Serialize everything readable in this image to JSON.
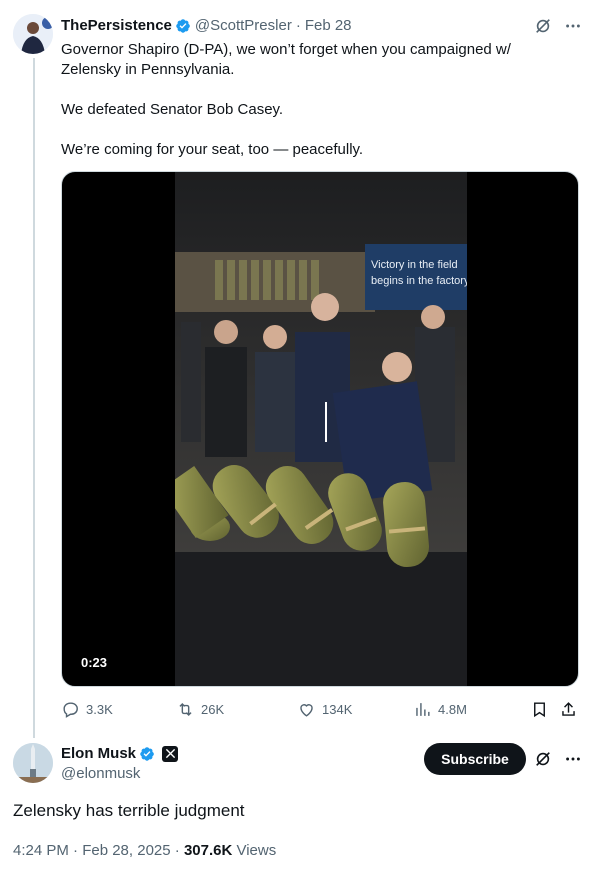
{
  "tweet1": {
    "author_name": "ThePersistence",
    "handle": "@ScottPresler",
    "separator": "·",
    "date": "Feb 28",
    "paragraphs": [
      "Governor Shapiro (D-PA), we won’t forget when you campaigned w/ Zelensky in Pennsylvania.",
      "We defeated Senator Bob Casey.",
      "We’re coming for your seat, too — peacefully."
    ],
    "video": {
      "duration": "0:23",
      "banner_line1": "Victory in the field",
      "banner_line2": "begins in the factory"
    },
    "stats": {
      "replies": "3.3K",
      "reposts": "26K",
      "likes": "134K",
      "views": "4.8M"
    }
  },
  "tweet2": {
    "author_name": "Elon Musk",
    "handle": "@elonmusk",
    "subscribe_label": "Subscribe",
    "text": "Zelensky has terrible judgment",
    "time": "4:24 PM · Feb 28, 2025 · ",
    "views_count": "307.6K",
    "views_label": " Views"
  },
  "colors": {
    "verified_blue": "#1d9bf0",
    "secondary_text": "#536471",
    "primary_text": "#0f1419",
    "divider": "#cfd9de"
  },
  "icons": [
    "verified-badge-icon",
    "grok-icon",
    "more-icon",
    "reply-icon",
    "repost-icon",
    "like-icon",
    "views-icon",
    "bookmark-icon",
    "share-icon",
    "x-affiliate-icon"
  ]
}
